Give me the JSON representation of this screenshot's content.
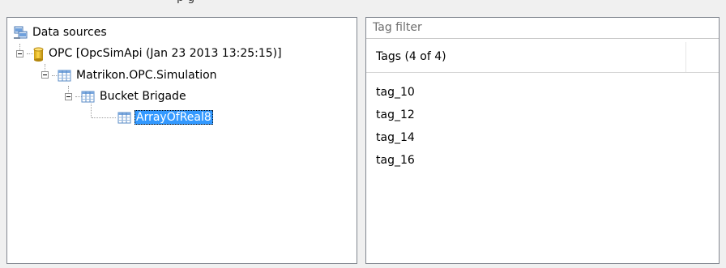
{
  "window": {
    "clipped_title_fragment": "p   g"
  },
  "tree": {
    "root": {
      "label": "Data sources",
      "icon": "data-sources-icon"
    },
    "server": {
      "label": "OPC [OpcSimApi (Jan 23 2013 13:25:15)]",
      "icon": "database-cylinder-icon"
    },
    "group1": {
      "label": "Matrikon.OPC.Simulation",
      "icon": "table-icon"
    },
    "group2": {
      "label": "Bucket Brigade",
      "icon": "table-icon"
    },
    "leaf": {
      "label": "ArrayOfReal8",
      "icon": "table-icon",
      "selected": true
    }
  },
  "tags": {
    "filter_placeholder": "Tag filter",
    "header": "Tags (4 of 4)",
    "items": [
      "tag_10",
      "tag_12",
      "tag_14",
      "tag_16"
    ]
  },
  "colors": {
    "selection": "#3399ff",
    "border": "#828790",
    "background": "#f0f0f0"
  }
}
